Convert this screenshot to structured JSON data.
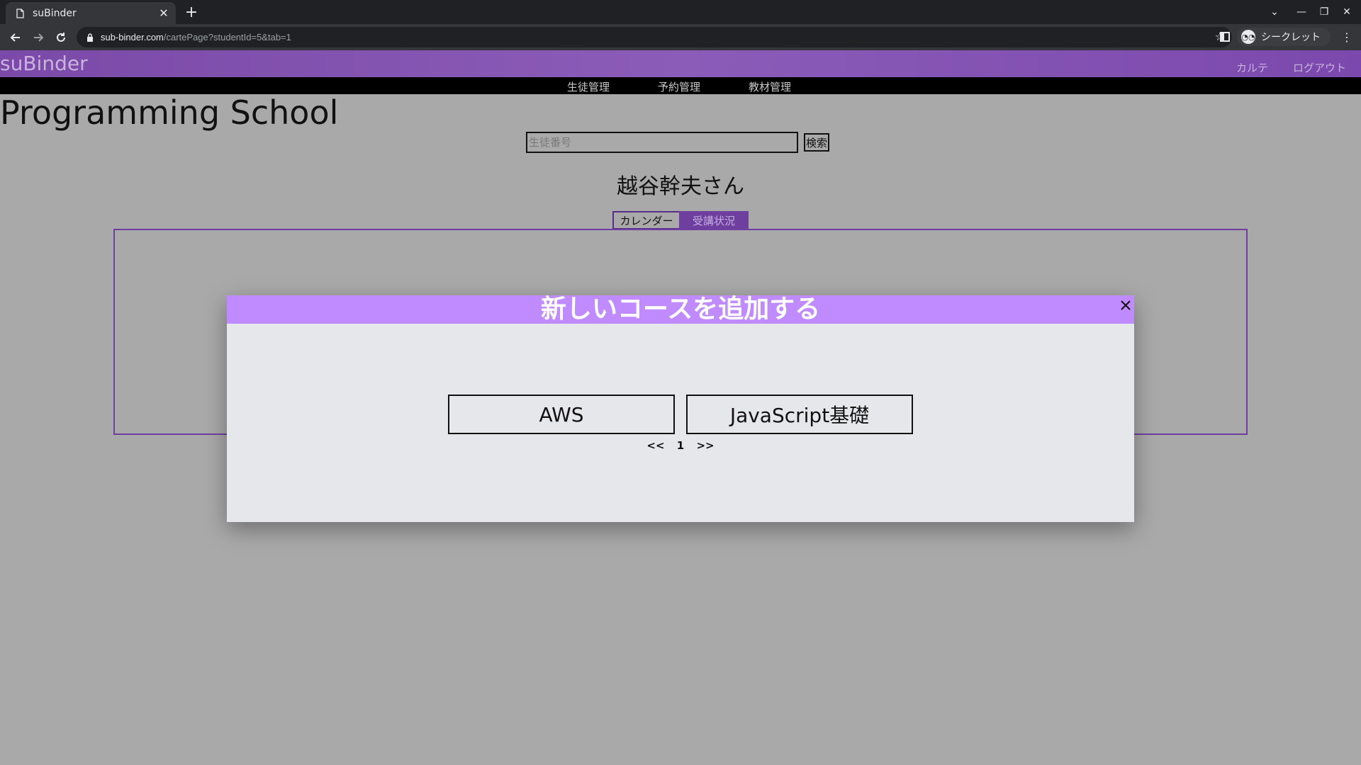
{
  "browser": {
    "tab_title": "suBinder",
    "url_host": "sub-binder.com",
    "url_path": "/cartePage?studentId=5&tab=1",
    "incognito_label": "シークレット"
  },
  "header": {
    "brand": "suBinder",
    "links": [
      "カルテ",
      "ログアウト"
    ]
  },
  "nav": {
    "items": [
      "生徒管理",
      "予約管理",
      "教材管理"
    ]
  },
  "page": {
    "school_title": "Programming School",
    "search_placeholder": "生徒番号",
    "search_button": "検索",
    "student_name": "越谷幹夫さん",
    "tabs": [
      "カレンダー",
      "受講状況"
    ]
  },
  "modal": {
    "title": "新しいコースを追加する",
    "courses": [
      "AWS",
      "JavaScript基礎"
    ],
    "pager": {
      "prev": "<<",
      "current": "1",
      "next": ">>"
    }
  },
  "colors": {
    "header_purple": "#8b5cb8",
    "modal_header": "#c08bff",
    "tab_active": "#6f3fa0",
    "overlay_gray": "#a9a9a9"
  }
}
